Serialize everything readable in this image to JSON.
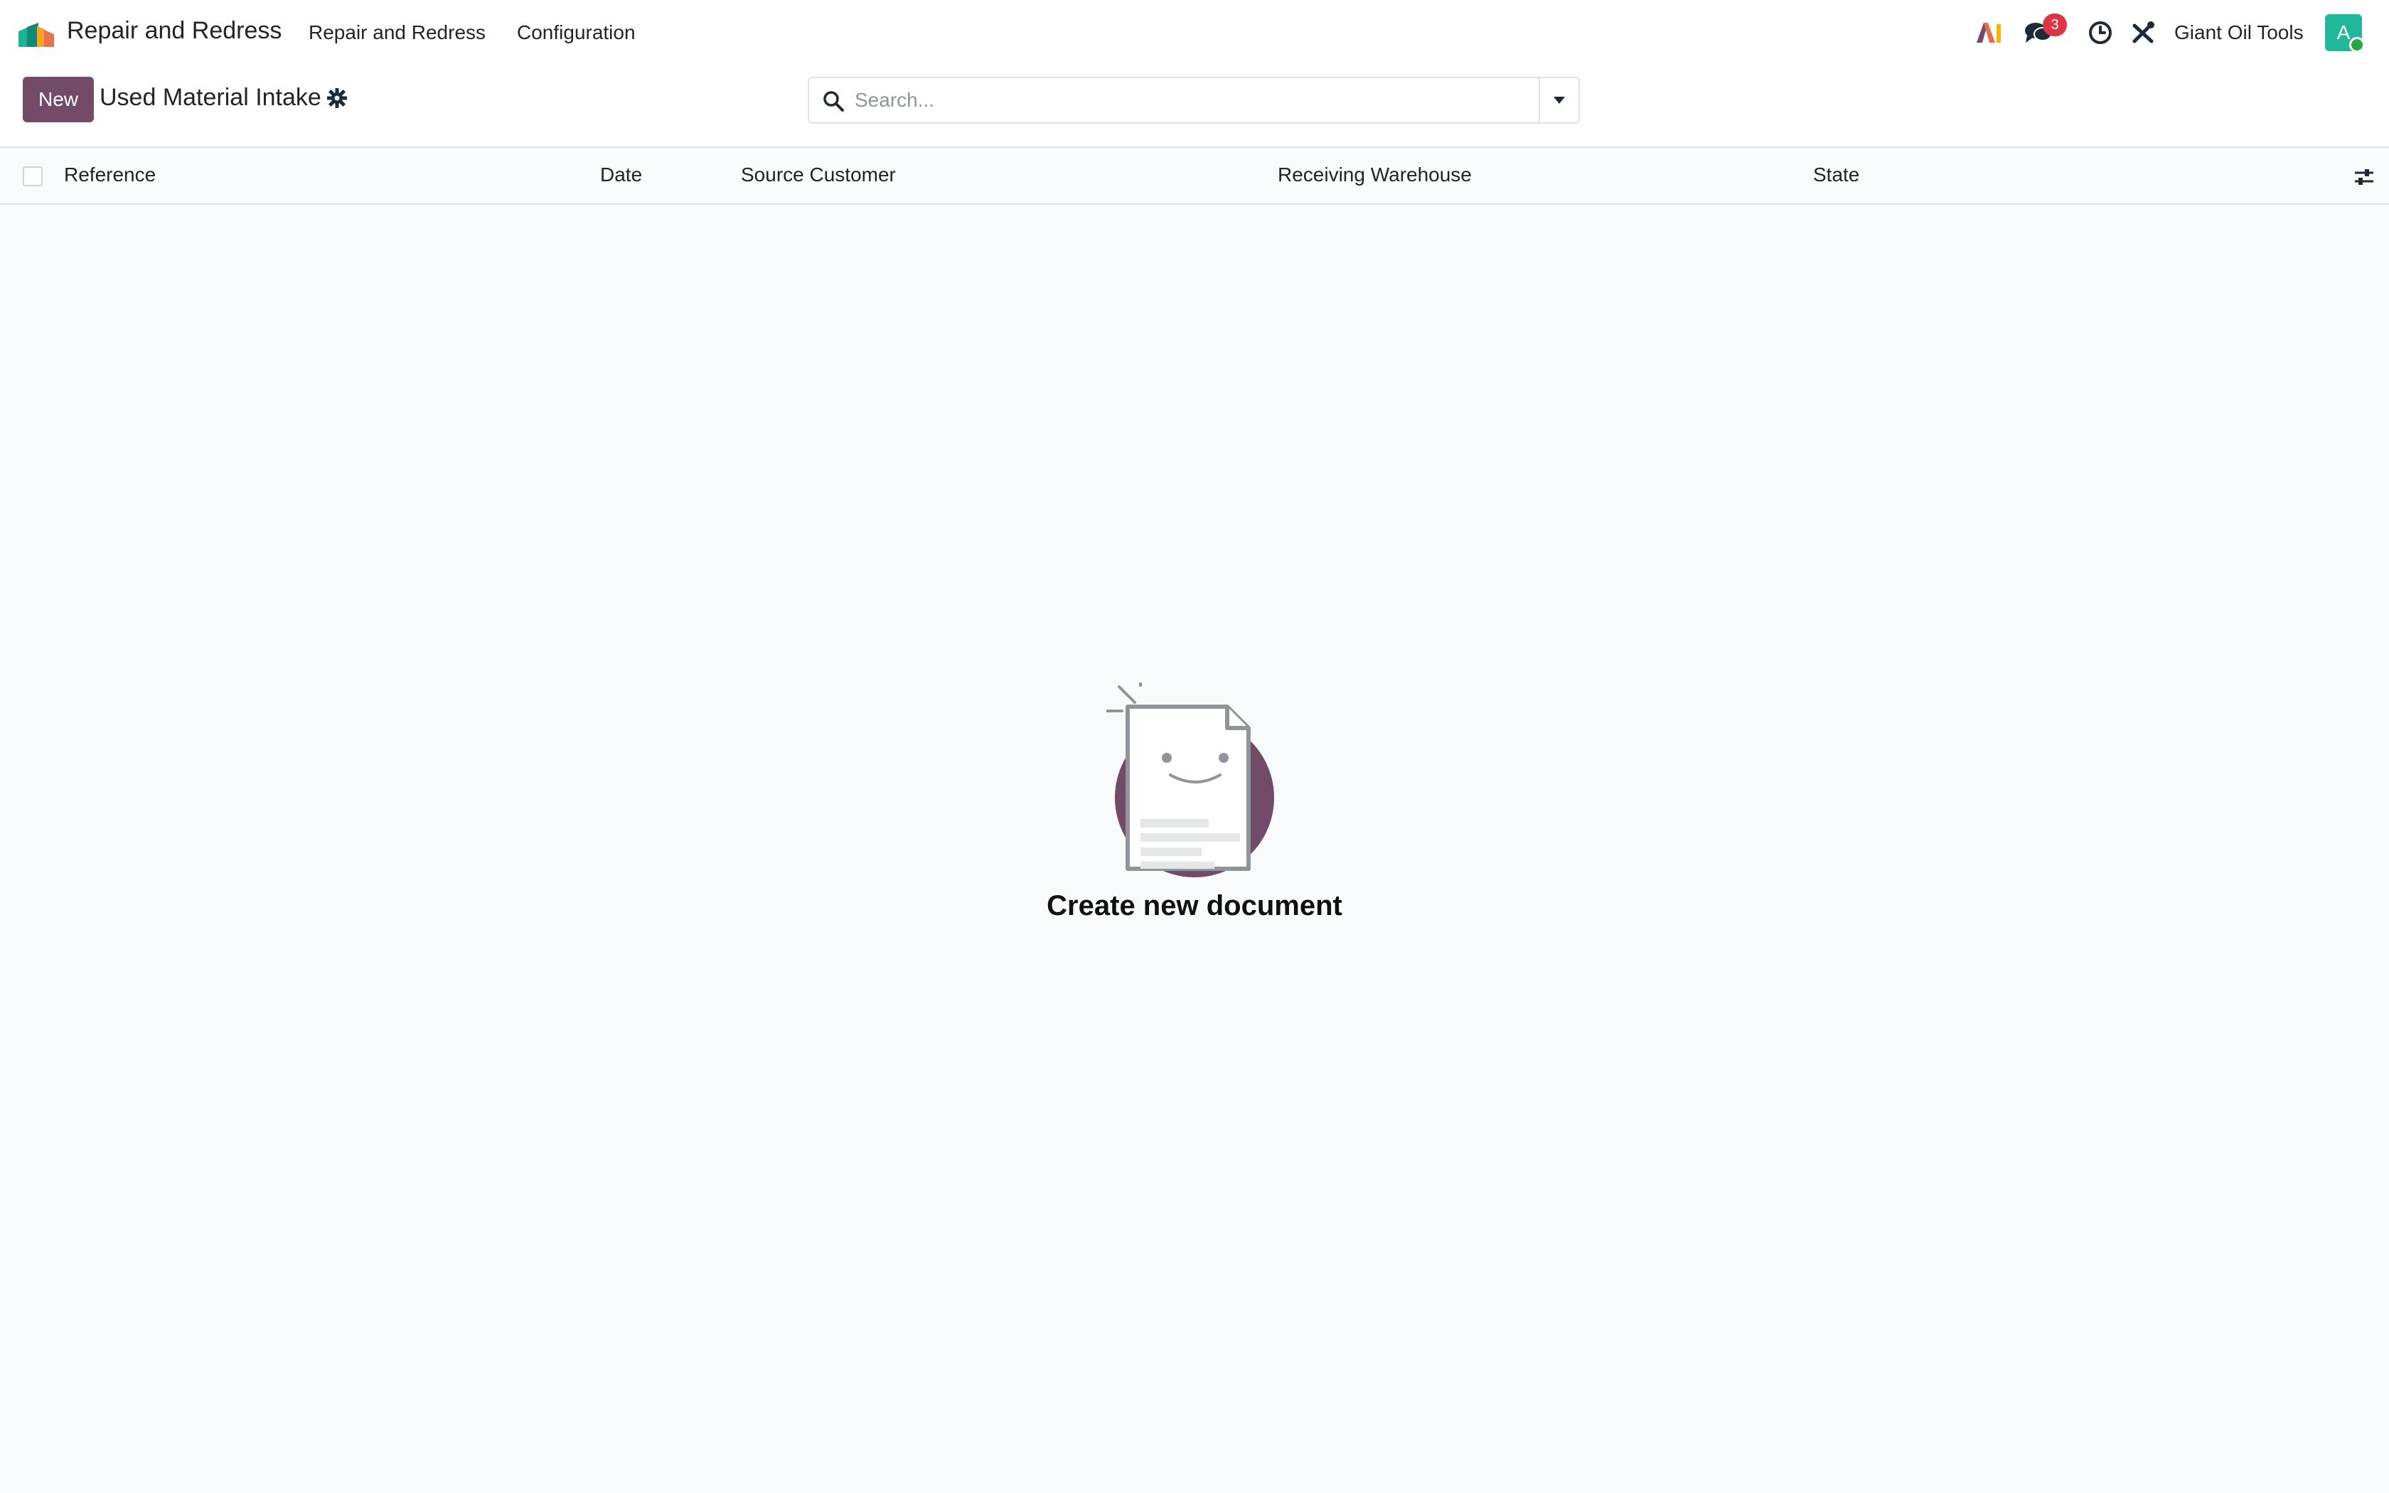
{
  "navbar": {
    "app_name": "Repair and Redress",
    "menu": [
      "Repair and Redress",
      "Configuration"
    ],
    "ai_icon": "ai-icon",
    "chat_badge": "3",
    "company": "Giant Oil Tools",
    "avatar_letter": "A"
  },
  "control_panel": {
    "new_label": "New",
    "title": "Used Material Intake",
    "search_placeholder": "Search..."
  },
  "list": {
    "columns": [
      "Reference",
      "Date",
      "Source Customer",
      "Receiving Warehouse",
      "State"
    ],
    "rows": []
  },
  "empty_state": {
    "title": "Create new document"
  },
  "colors": {
    "brand": "#714b67",
    "badge": "#dc3545",
    "avatar": "#21b799"
  }
}
